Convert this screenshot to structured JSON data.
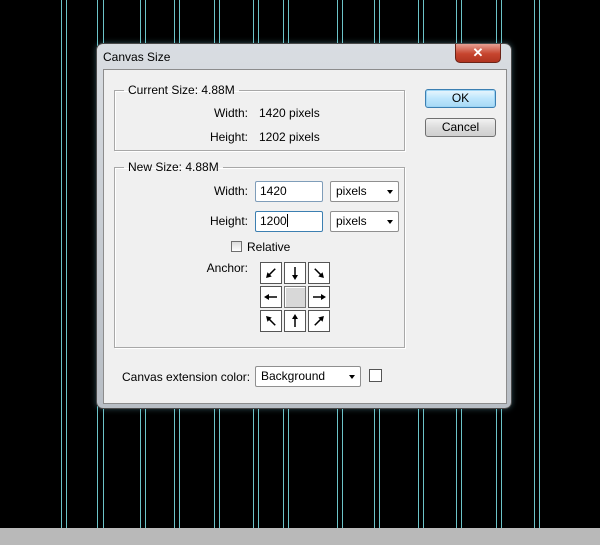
{
  "dialog": {
    "title": "Canvas Size",
    "close_glyph": "✕",
    "current_size": {
      "legend": "Current Size: 4.88M",
      "width_label": "Width:",
      "width_value": "1420 pixels",
      "height_label": "Height:",
      "height_value": "1202 pixels"
    },
    "new_size": {
      "legend": "New Size: 4.88M",
      "width_label": "Width:",
      "width_value": "1420",
      "width_unit": "pixels",
      "height_label": "Height:",
      "height_value": "1200",
      "height_unit": "pixels",
      "relative_label": "Relative",
      "relative_checked": false,
      "anchor_label": "Anchor:",
      "anchor_selected": "center"
    },
    "extension": {
      "label": "Canvas extension color:",
      "value": "Background",
      "swatch_color": "#ffffff"
    },
    "buttons": {
      "ok": "OK",
      "cancel": "Cancel"
    }
  },
  "colors": {
    "backdrop": "#000000",
    "guide_lines": "#7fe6ec",
    "dialog_face": "#f0f0f0"
  },
  "icons": [
    "arrow-icon",
    "close-icon",
    "chevron-down-icon"
  ]
}
